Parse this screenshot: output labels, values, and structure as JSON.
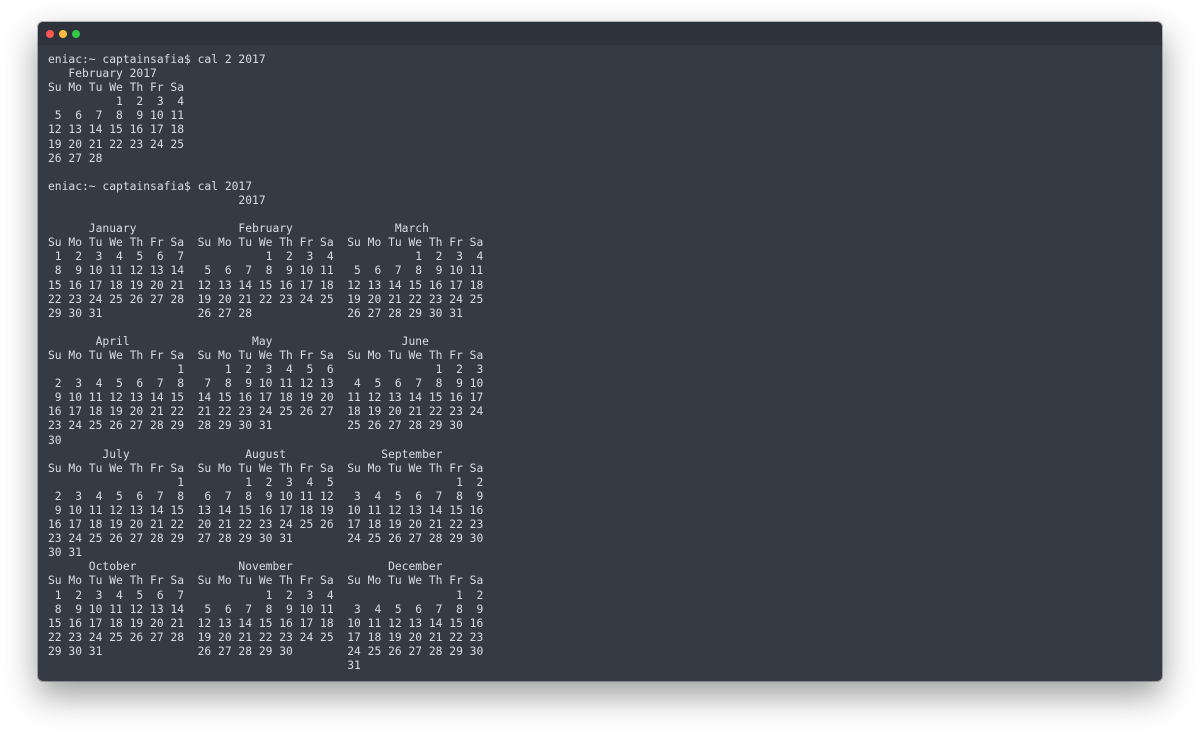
{
  "window": {
    "title": ""
  },
  "terminal": {
    "lines": [
      "eniac:~ captainsafia$ cal 2 2017",
      "   February 2017",
      "Su Mo Tu We Th Fr Sa",
      "          1  2  3  4",
      " 5  6  7  8  9 10 11",
      "12 13 14 15 16 17 18",
      "19 20 21 22 23 24 25",
      "26 27 28",
      "",
      "eniac:~ captainsafia$ cal 2017",
      "                            2017",
      "",
      "      January               February               March",
      "Su Mo Tu We Th Fr Sa  Su Mo Tu We Th Fr Sa  Su Mo Tu We Th Fr Sa",
      " 1  2  3  4  5  6  7            1  2  3  4            1  2  3  4",
      " 8  9 10 11 12 13 14   5  6  7  8  9 10 11   5  6  7  8  9 10 11",
      "15 16 17 18 19 20 21  12 13 14 15 16 17 18  12 13 14 15 16 17 18",
      "22 23 24 25 26 27 28  19 20 21 22 23 24 25  19 20 21 22 23 24 25",
      "29 30 31              26 27 28              26 27 28 29 30 31",
      "",
      "       April                  May                   June",
      "Su Mo Tu We Th Fr Sa  Su Mo Tu We Th Fr Sa  Su Mo Tu We Th Fr Sa",
      "                   1      1  2  3  4  5  6               1  2  3",
      " 2  3  4  5  6  7  8   7  8  9 10 11 12 13   4  5  6  7  8  9 10",
      " 9 10 11 12 13 14 15  14 15 16 17 18 19 20  11 12 13 14 15 16 17",
      "16 17 18 19 20 21 22  21 22 23 24 25 26 27  18 19 20 21 22 23 24",
      "23 24 25 26 27 28 29  28 29 30 31           25 26 27 28 29 30",
      "30",
      "        July                 August              September",
      "Su Mo Tu We Th Fr Sa  Su Mo Tu We Th Fr Sa  Su Mo Tu We Th Fr Sa",
      "                   1         1  2  3  4  5                  1  2",
      " 2  3  4  5  6  7  8   6  7  8  9 10 11 12   3  4  5  6  7  8  9",
      " 9 10 11 12 13 14 15  13 14 15 16 17 18 19  10 11 12 13 14 15 16",
      "16 17 18 19 20 21 22  20 21 22 23 24 25 26  17 18 19 20 21 22 23",
      "23 24 25 26 27 28 29  27 28 29 30 31        24 25 26 27 28 29 30",
      "30 31",
      "      October               November              December",
      "Su Mo Tu We Th Fr Sa  Su Mo Tu We Th Fr Sa  Su Mo Tu We Th Fr Sa",
      " 1  2  3  4  5  6  7            1  2  3  4                  1  2",
      " 8  9 10 11 12 13 14   5  6  7  8  9 10 11   3  4  5  6  7  8  9",
      "15 16 17 18 19 20 21  12 13 14 15 16 17 18  10 11 12 13 14 15 16",
      "22 23 24 25 26 27 28  19 20 21 22 23 24 25  17 18 19 20 21 22 23",
      "29 30 31              26 27 28 29 30        24 25 26 27 28 29 30",
      "                                            31"
    ]
  },
  "colors": {
    "window_bg": "#353b45",
    "titlebar_bg": "#2e333b",
    "text": "#d8dde5",
    "close": "#fc5753",
    "minimize": "#fdbc40",
    "zoom": "#33c748"
  }
}
